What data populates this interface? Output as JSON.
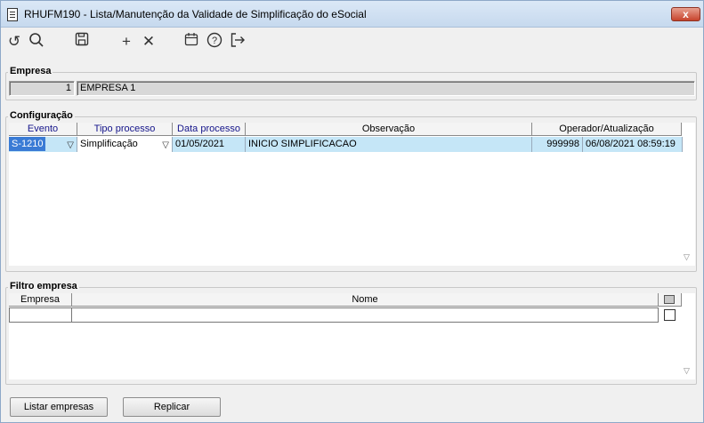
{
  "window": {
    "title": "RHUFM190 - Lista/Manutenção da Validade de Simplificação do eSocial",
    "close_label": "x"
  },
  "toolbar": {
    "icons": [
      "refresh-icon",
      "search-icon",
      "save-icon",
      "add-icon",
      "delete-icon",
      "calendar-icon",
      "help-icon",
      "exit-icon"
    ]
  },
  "empresa": {
    "label": "Empresa",
    "code": "1",
    "name": "EMPRESA 1"
  },
  "configuracao": {
    "label": "Configuração",
    "columns": [
      "Evento",
      "Tipo processo",
      "Data processo",
      "Observação",
      "Operador/Atualização"
    ],
    "rows": [
      {
        "evento": "S-1210",
        "tipo": "Simplificação",
        "data": "01/05/2021",
        "observacao": "INICIO SIMPLIFICACAO",
        "operador": "999998",
        "atualizacao": "06/08/2021 08:59:19"
      }
    ]
  },
  "filtro": {
    "label": "Filtro empresa",
    "columns": [
      "Empresa",
      "Nome"
    ]
  },
  "buttons": {
    "listar": "Listar empresas",
    "replicar": "Replicar"
  }
}
